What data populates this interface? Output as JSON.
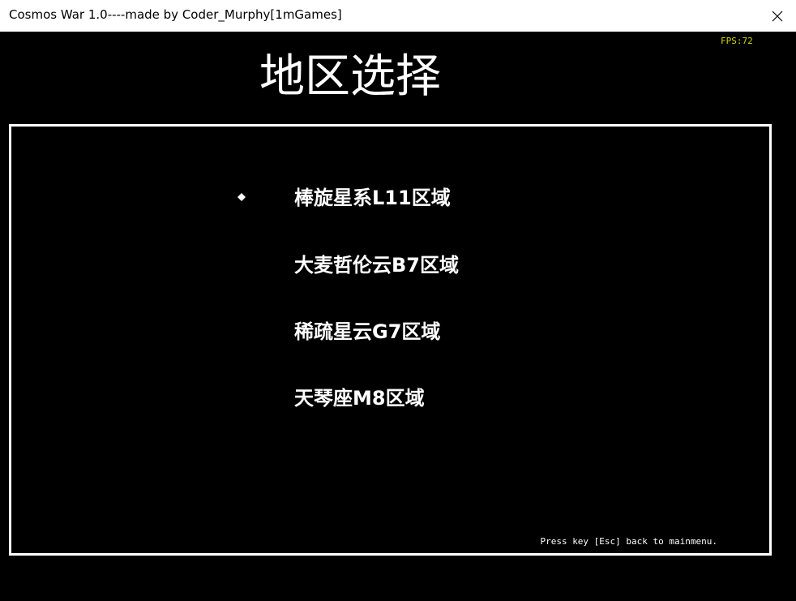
{
  "window": {
    "title": "Cosmos War 1.0----made by Coder_Murphy[1mGames]"
  },
  "hud": {
    "fps_label": "FPS:72"
  },
  "screen": {
    "heading": "地区选择",
    "regions": [
      {
        "label": "棒旋星系L11区域",
        "selected": true
      },
      {
        "label": "大麦哲伦云B7区域",
        "selected": false
      },
      {
        "label": "稀疏星云G7区域",
        "selected": false
      },
      {
        "label": "天琴座M8区域",
        "selected": false
      }
    ],
    "hint": "Press key [Esc] back to mainmenu."
  },
  "colors": {
    "background": "#000000",
    "text": "#ffffff",
    "fps": "#d4d400",
    "titlebar": "#ffffff"
  },
  "icons": {
    "selection_cursor": "diamond-icon",
    "close": "close-icon"
  }
}
